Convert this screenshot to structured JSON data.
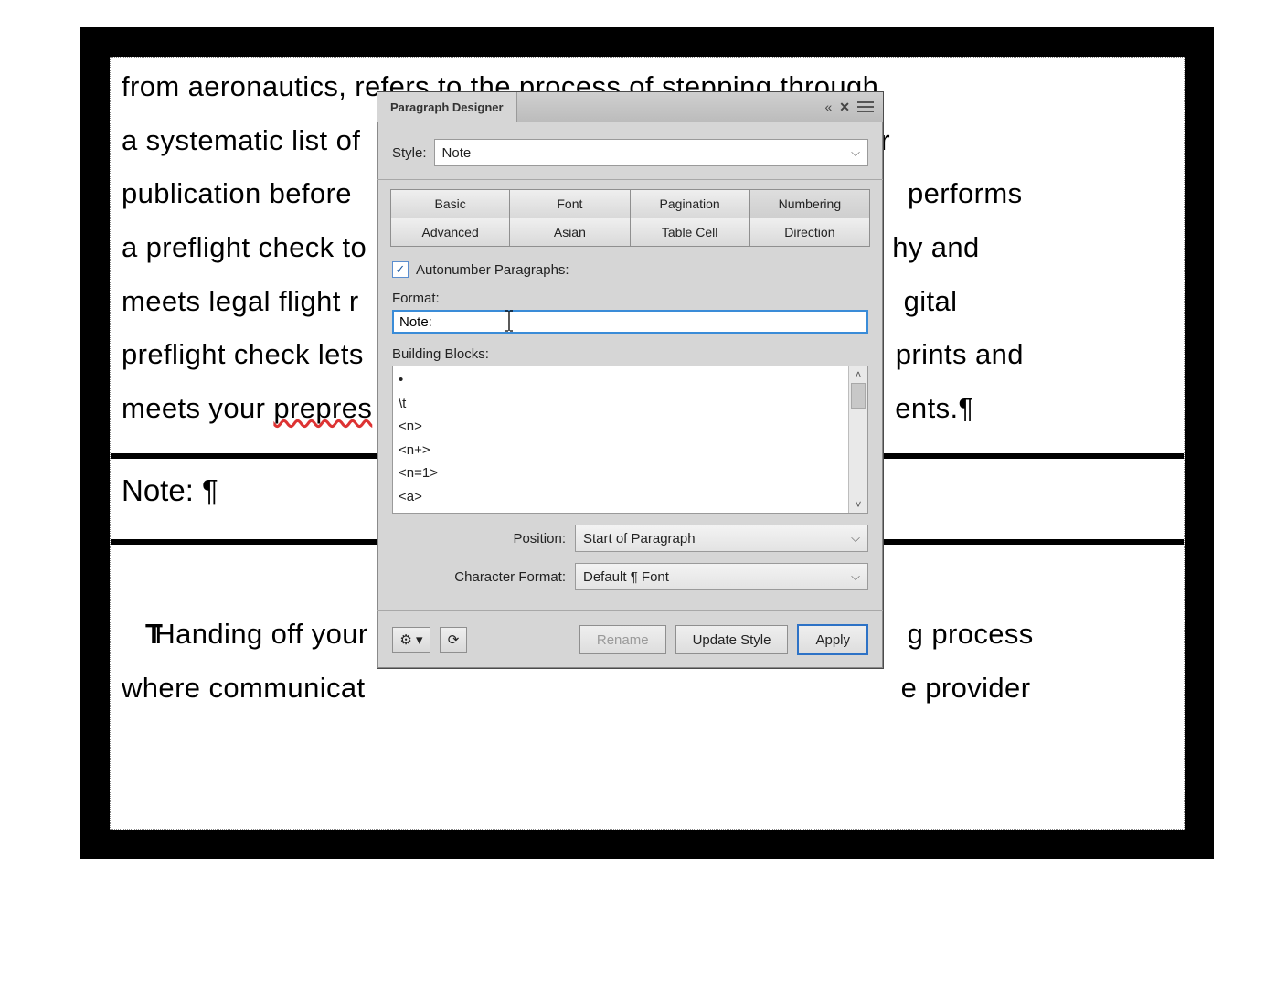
{
  "document": {
    "para1_l1": "from aeronautics, refers to the process of stepping through",
    "para1_l2a": "a systematic list of ",
    "para1_l2b": "r",
    "para1_l3a": "publication before ",
    "para1_l3b": " performs",
    "para1_l4a": "a preflight check to",
    "para1_l4b": "hy and",
    "para1_l5a": "meets legal flight r",
    "para1_l5b": "gital",
    "para1_l6a": "preflight check lets",
    "para1_l6b": "prints and",
    "para1_l7a": "meets your ",
    "para1_l7_sq": "prepres",
    "para1_l7b": "ents.¶",
    "note_line": "Note: ¶",
    "para2_l1a": "Handing off your",
    "para2_l1b": "g process",
    "para2_l2a": "where communicat",
    "para2_l2b": "e provider"
  },
  "dialog": {
    "title": "Paragraph Designer",
    "close_glyph": "✕",
    "collapse_glyph": "«",
    "style_label": "Style:",
    "style_value": "Note",
    "tabs_row1": [
      "Basic",
      "Font",
      "Pagination",
      "Numbering"
    ],
    "tabs_row2": [
      "Advanced",
      "Asian",
      "Table Cell",
      "Direction"
    ],
    "autonumber_label": "Autonumber Paragraphs:",
    "autonumber_checked": "✓",
    "format_label": "Format:",
    "format_value": "Note:",
    "building_blocks_label": "Building Blocks:",
    "building_blocks_items": [
      "•",
      "\\t",
      "<n>",
      "<n+>",
      "<n=1>",
      "<a>"
    ],
    "position_label": "Position:",
    "position_value": "Start of Paragraph",
    "charformat_label": "Character Format:",
    "charformat_value": "Default ¶ Font",
    "rename_label": "Rename",
    "update_label": "Update Style",
    "apply_label": "Apply",
    "gear_glyph": "⚙ ▾",
    "refresh_glyph": "⟳"
  }
}
